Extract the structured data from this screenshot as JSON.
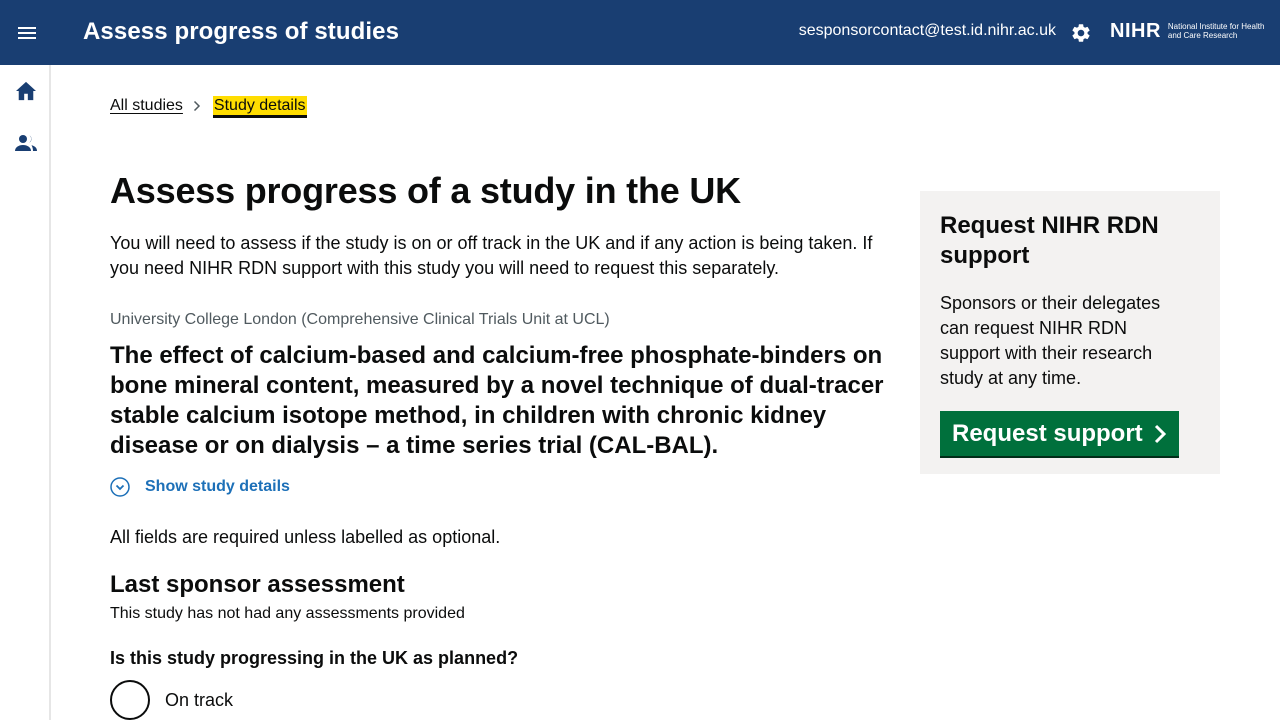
{
  "header": {
    "app_title": "Assess progress of studies",
    "user_email": "sesponsorcontact@test.id.nihr.ac.uk",
    "logo_mark": "NIHR",
    "logo_sub": "National Institute for Health and Care Research"
  },
  "sidebar": {
    "items": [
      {
        "icon": "home-icon"
      },
      {
        "icon": "people-icon"
      }
    ]
  },
  "breadcrumb": {
    "items": [
      "All studies",
      "Study details"
    ]
  },
  "main": {
    "title": "Assess progress of a study in the UK",
    "intro": "You will need to assess if the study is on or off track in the UK and if any action is being taken. If you need NIHR RDN support with this study you will need to request this separately.",
    "organisation": "University College London (Comprehensive Clinical Trials Unit at UCL)",
    "study_title": "The effect of calcium-based and calcium-free phosphate-binders on bone mineral content, measured by a novel technique of dual-tracer stable calcium isotope method, in children with chronic kidney disease or on dialysis – a time series trial (CAL-BAL).",
    "show_details": "Show study details",
    "required_note": "All fields are required unless labelled as optional.",
    "last_assessment_heading": "Last sponsor assessment",
    "last_assessment_text": "This study has not had any assessments provided",
    "question": "Is this study progressing in the UK as planned?",
    "options": [
      "On track"
    ]
  },
  "aside": {
    "heading": "Request NIHR RDN support",
    "text": "Sponsors or their delegates can request NIHR RDN support with their research study at any time.",
    "button_label": "Request support"
  },
  "colors": {
    "header_bg": "#193e72",
    "link": "#1d70b8",
    "button": "#00703c",
    "highlight": "#ffdd00",
    "aside_bg": "#f3f2f1"
  }
}
